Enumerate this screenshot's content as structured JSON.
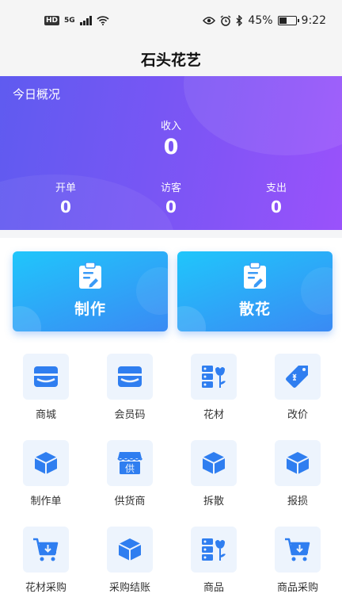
{
  "status_bar": {
    "hd": "HD",
    "network": "5G",
    "battery": "45%",
    "time": "9:22"
  },
  "header": {
    "title": "石头花艺"
  },
  "overview": {
    "title": "今日概况",
    "income": {
      "label": "收入",
      "value": "0"
    },
    "stats": [
      {
        "label": "开单",
        "value": "0"
      },
      {
        "label": "访客",
        "value": "0"
      },
      {
        "label": "支出",
        "value": "0"
      }
    ]
  },
  "actions": [
    {
      "label": "制作",
      "icon": "clipboard-icon"
    },
    {
      "label": "散花",
      "icon": "clipboard-icon"
    }
  ],
  "menu": [
    {
      "label": "商城",
      "icon": "store-icon"
    },
    {
      "label": "会员码",
      "icon": "store-icon"
    },
    {
      "label": "花材",
      "icon": "flower-shelf-icon"
    },
    {
      "label": "改价",
      "icon": "price-tag-icon"
    },
    {
      "label": "制作单",
      "icon": "box-icon"
    },
    {
      "label": "供货商",
      "icon": "supplier-shop-icon"
    },
    {
      "label": "拆散",
      "icon": "box-icon"
    },
    {
      "label": "报损",
      "icon": "box-icon"
    },
    {
      "label": "花材采购",
      "icon": "cart-icon"
    },
    {
      "label": "采购结账",
      "icon": "box-icon"
    },
    {
      "label": "商品",
      "icon": "flower-shelf-icon"
    },
    {
      "label": "商品采购",
      "icon": "cart-icon"
    }
  ],
  "supplier_icon_text": "供",
  "colors": {
    "accent": "#3a8af4",
    "icon_blue": "#2f7ef0",
    "banner_start": "#5f5bf0",
    "banner_end": "#9a52fb"
  }
}
